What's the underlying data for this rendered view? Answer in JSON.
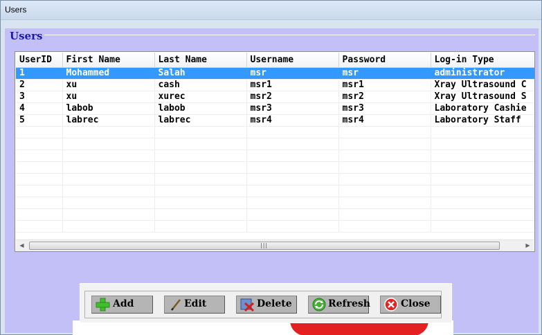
{
  "window": {
    "title": "Users"
  },
  "group": {
    "label": "Users"
  },
  "grid": {
    "columns": [
      "UserID",
      "First Name",
      "Last Name",
      "Username",
      "Password",
      "Log-in Type"
    ],
    "rows": [
      [
        "1",
        "Mohammed",
        "Salah",
        "msr",
        "msr",
        "administrator"
      ],
      [
        "2",
        "xu",
        "cash",
        "msr1",
        "msr1",
        "Xray Ultrasound C"
      ],
      [
        "3",
        "xu",
        "xurec",
        "msr2",
        "msr2",
        "Xray Ultrasound S"
      ],
      [
        "4",
        "labob",
        "labob",
        "msr3",
        "msr3",
        "Laboratory Cashie"
      ],
      [
        "5",
        "labrec",
        "labrec",
        "msr4",
        "msr4",
        "Laboratory Staff"
      ]
    ],
    "selected_row": 0,
    "empty_rows": 9
  },
  "toolbar": {
    "add_label": "Add",
    "edit_label": "Edit",
    "delete_label": "Delete",
    "refresh_label": "Refresh",
    "close_label": "Close"
  },
  "colors": {
    "client_bg": "#c3c0f8",
    "selection": "#3399ff",
    "group_label": "#1a1aa8"
  },
  "icons": {
    "add": "green-plus-icon",
    "edit": "pencil-icon",
    "delete": "delete-x-icon",
    "refresh": "refresh-arrows-icon",
    "close": "red-x-icon"
  }
}
